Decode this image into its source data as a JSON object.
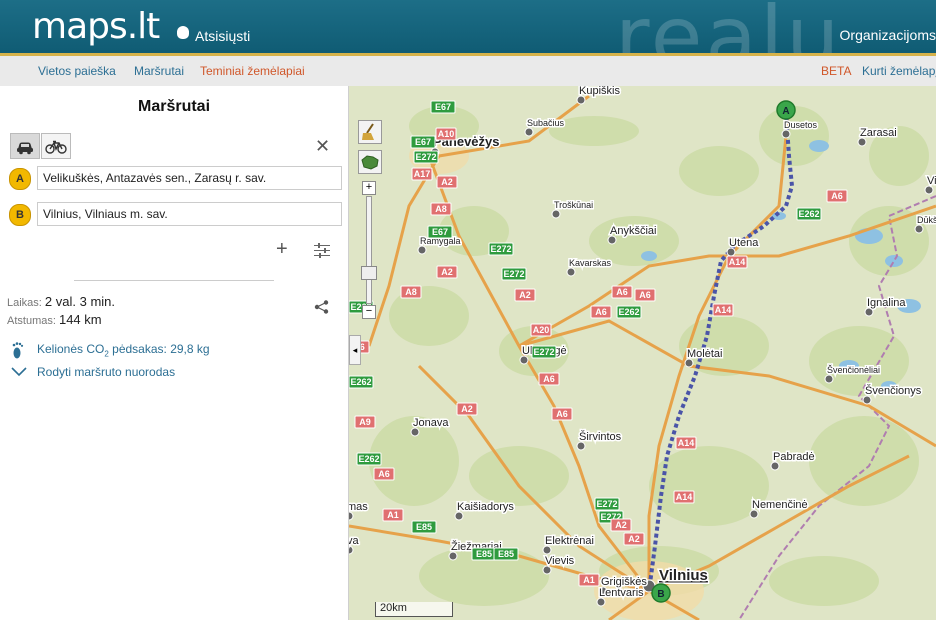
{
  "header": {
    "logo": "maps.lt",
    "download_label": "Atsisiųsti",
    "watermark": "realu",
    "org_label": "Organizacijoms"
  },
  "nav": {
    "tabs": [
      {
        "label": "Vietos paieška",
        "active": false
      },
      {
        "label": "Maršrutai",
        "active": false
      },
      {
        "label": "Teminiai žemėlapiai",
        "active": true
      }
    ],
    "beta": "BETA",
    "create_map": "Kurti žemėlapį"
  },
  "panel": {
    "title": "Maršrutai",
    "modes": [
      "car-icon",
      "bicycle-icon"
    ],
    "waypoints": [
      {
        "marker": "A",
        "value": "Velikuškės, Antazavės sen., Zarasų r. sav."
      },
      {
        "marker": "B",
        "value": "Vilnius, Vilniaus m. sav."
      }
    ],
    "time_label": "Laikas:",
    "time_value": "2 val. 3 min.",
    "distance_label": "Atstumas:",
    "distance_value": "144 km",
    "co2_label": "Kelionės CO",
    "co2_sub": "2",
    "co2_rest": " pėdsakas: 29,8 kg",
    "directions_label": "Rodyti maršruto nuorodas"
  },
  "map": {
    "scale_label": "20km",
    "route_color": "#4a54a8",
    "places": [
      {
        "name": "Kupiškis",
        "size": "s"
      },
      {
        "name": "Subačius",
        "size": "xs"
      },
      {
        "name": "Panevėžys",
        "size": "l"
      },
      {
        "name": "Dusetos",
        "size": "xs"
      },
      {
        "name": "Zarasai",
        "size": "s"
      },
      {
        "name": "Visaginas",
        "size": "s"
      },
      {
        "name": "Dūkštas",
        "size": "xs"
      },
      {
        "name": "Troškūnai",
        "size": "xs"
      },
      {
        "name": "Anykščiai",
        "size": "s"
      },
      {
        "name": "Ramygala",
        "size": "xs"
      },
      {
        "name": "Utena",
        "size": "s"
      },
      {
        "name": "Kavarskas",
        "size": "xs"
      },
      {
        "name": "Ignalina",
        "size": "s"
      },
      {
        "name": "Ukmergė",
        "size": "s"
      },
      {
        "name": "Molėtai",
        "size": "s"
      },
      {
        "name": "Švenčionėliai",
        "size": "xs"
      },
      {
        "name": "Švenčionys",
        "size": "s"
      },
      {
        "name": "Jonava",
        "size": "s"
      },
      {
        "name": "Širvintos",
        "size": "s"
      },
      {
        "name": "Pabradė",
        "size": "s"
      },
      {
        "name": "Kaišiadorys",
        "size": "s"
      },
      {
        "name": "Nemenčinė",
        "size": "s"
      },
      {
        "name": "Elektrėnai",
        "size": "s"
      },
      {
        "name": "Žiežmariai",
        "size": "s"
      },
      {
        "name": "Vievis",
        "size": "s"
      },
      {
        "name": "Vilnius",
        "size": "xl"
      },
      {
        "name": "Grigiškės",
        "size": "s"
      },
      {
        "name": "Lentvaris",
        "size": "s"
      },
      {
        "name": "mas",
        "size": "s"
      },
      {
        "name": "va",
        "size": "s"
      }
    ],
    "road_shields": [
      "E67",
      "A10",
      "E67",
      "E272",
      "A17",
      "A2",
      "A8",
      "E67",
      "E272",
      "A2",
      "E272",
      "A8",
      "A2",
      "A20",
      "E272",
      "A6",
      "A2",
      "A6",
      "A6",
      "E262",
      "A6",
      "E262",
      "A6",
      "E262",
      "A6",
      "E262",
      "A14",
      "A14",
      "A14",
      "A14",
      "E262",
      "A1",
      "E85",
      "E85",
      "E85",
      "E272",
      "E272",
      "A2",
      "A2",
      "A1",
      "A9",
      "A6",
      "A6"
    ],
    "markers": [
      "A",
      "B"
    ]
  }
}
